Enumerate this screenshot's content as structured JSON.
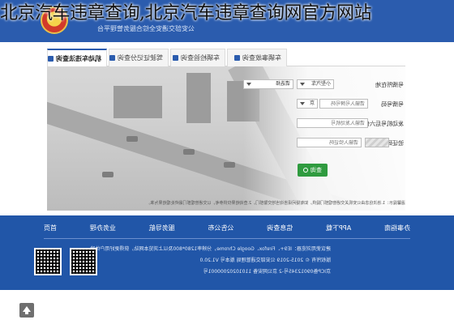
{
  "caption": "北京汽车违章查询,北京汽车违章查询网官方网站",
  "header": {
    "brand_text": "公安部交通安全综合服务管理平台"
  },
  "tabs": [
    {
      "label": "机动车违法查询",
      "icon": "car-icon"
    },
    {
      "label": "驾驶证记分查询",
      "icon": "id-card-icon"
    },
    {
      "label": "车辆检验查询",
      "icon": "check-icon"
    },
    {
      "label": "车辆事故查询",
      "icon": "warning-icon"
    }
  ],
  "form": {
    "province_label": "号牌所在地",
    "province_value": "请选择",
    "plate_type_value": "小型汽车",
    "plate_label": "号牌号码",
    "plate_prefix": "京",
    "plate_placeholder": "请输入号牌号码",
    "vin_label": "发动机号后六位",
    "vin_placeholder": "请输入发动机号",
    "captcha_label": "验证码",
    "captcha_placeholder": "请输入验证码",
    "query_label": "查询"
  },
  "notice": "温馨提示：1.违法信息由公安机关交通管理部门提供，如有疑问请咨询当地交警部门。2.查询结果仅供参考，以交通管理部门最终处理结果为准。",
  "footer": {
    "nav": [
      "首页",
      "业务办理",
      "服务导航",
      "公告公布",
      "信息查询",
      "APP下载",
      "办事指南"
    ],
    "info_line1": "建议使用浏览器：IE9+、Firefox、Google Chrome，分辨率1280*800及以上浏览本网站，获得更好用户体验。",
    "info_line2": "版权所有 © 2015-2019 公安部交通管理局 版本号 V1.20.0",
    "info_line3": "京ICP备09012345号-2  京公网安备 11010202000001号"
  },
  "colors": {
    "brand_blue": "#2b5cae",
    "footer_blue": "#2156a8",
    "query_green": "#2f9b3f"
  }
}
